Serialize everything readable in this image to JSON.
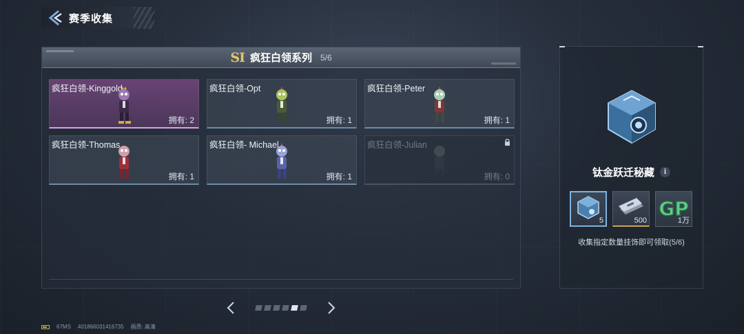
{
  "header": {
    "title": "赛季收集"
  },
  "panel": {
    "logo": "SI",
    "series_title": "疯狂白领系列",
    "series_progress": "5/6",
    "cards": [
      {
        "name": "疯狂白领-Kinggold",
        "owned": "拥有: 2",
        "style": "rare",
        "locked": false
      },
      {
        "name": "疯狂白领-Opt",
        "owned": "拥有: 1",
        "style": "normal",
        "locked": false
      },
      {
        "name": "疯狂白领-Peter",
        "owned": "拥有: 1",
        "style": "normal",
        "locked": false
      },
      {
        "name": "疯狂白领-Thomas",
        "owned": "拥有: 1",
        "style": "normal",
        "locked": false
      },
      {
        "name": "疯狂白领- Michael",
        "owned": "拥有: 1",
        "style": "normal",
        "locked": false
      },
      {
        "name": "疯狂白领-Julian",
        "owned": "拥有: 0",
        "style": "locked",
        "locked": true
      }
    ]
  },
  "pager": {
    "total": 6,
    "active_index": 4
  },
  "reward": {
    "title": "钛金跃迁秘藏",
    "info_icon": "i",
    "items": [
      {
        "icon": "crystal-cube-icon",
        "qty": "5",
        "selected": true
      },
      {
        "icon": "card-stack-icon",
        "qty": "500",
        "selected": false
      },
      {
        "icon": "gp-currency-icon",
        "label": "GP",
        "qty": "1万",
        "selected": false
      }
    ],
    "description": "收集指定数量挂饰即可领取(5/6)"
  },
  "footer": {
    "ping": "67MS",
    "player_id": "401866031416735",
    "quality_label": "画质:",
    "quality_value": "高清"
  },
  "colors": {
    "rare": "#d9a3e6",
    "normal": "#6f8da8",
    "accent_gold": "#e8c26a"
  }
}
